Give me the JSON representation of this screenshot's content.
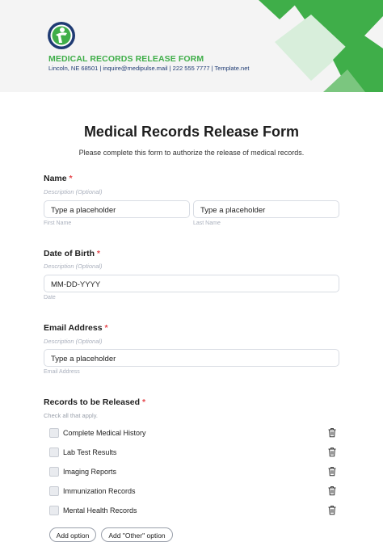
{
  "header": {
    "brand_title": "MEDICAL RECORDS RELEASE FORM",
    "contact": "Lincoln, NE 68501 | inquire@medipulse.mail | 222 555 7777 | Template.net"
  },
  "form": {
    "title": "Medical Records Release Form",
    "subtitle": "Please complete this form to authorize the release of medical records."
  },
  "name": {
    "label": "Name",
    "required_mark": "*",
    "description": "Description (Optional)",
    "first_value": "Type a placeholder",
    "last_value": "Type a placeholder",
    "first_sublabel": "First Name",
    "last_sublabel": "Last Name"
  },
  "dob": {
    "label": "Date of Birth",
    "required_mark": "*",
    "description": "Description (Optional)",
    "value": "MM-DD-YYYY",
    "sublabel": "Date"
  },
  "email": {
    "label": "Email Address",
    "required_mark": "*",
    "description": "Description (Optional)",
    "value": "Type a placeholder",
    "sublabel": "Email Address"
  },
  "records": {
    "label": "Records to be Released",
    "required_mark": "*",
    "help": "Check all that apply.",
    "options": [
      "Complete Medical History",
      "Lab Test Results",
      "Imaging Reports",
      "Immunization Records",
      "Mental Health Records"
    ],
    "add_option": "Add option",
    "add_other": "Add \"Other\" option"
  },
  "colors": {
    "brand_green": "#3fae49",
    "brand_navy": "#1f3b73",
    "required_red": "#e5484d"
  },
  "icons": {
    "logo": "person-running-logo",
    "trash": "trash-icon"
  }
}
